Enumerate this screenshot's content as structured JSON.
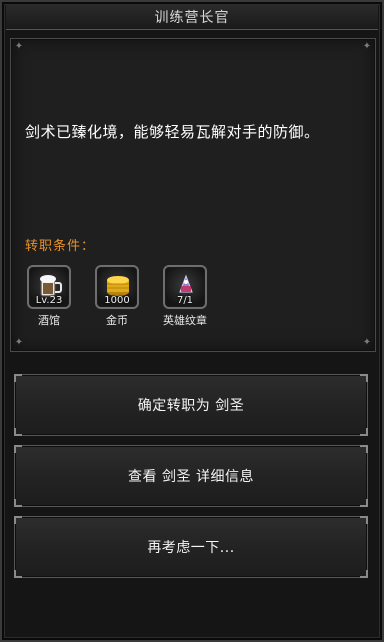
{
  "dialog": {
    "title": "训练营长官",
    "description": "剑术已臻化境，能够轻易瓦解对手的防御。",
    "conditions_label": "转职条件：",
    "requirements": [
      {
        "value": "Lv.23",
        "name": "酒馆",
        "icon": "tavern-icon"
      },
      {
        "value": "1000",
        "name": "金币",
        "icon": "gold-coin-icon"
      },
      {
        "value": "7/1",
        "name": "英雄纹章",
        "icon": "hero-emblem-icon"
      }
    ]
  },
  "buttons": {
    "confirm": "确定转职为 剑圣",
    "details": "查看 剑圣 详细信息",
    "reconsider": "再考虑一下..."
  },
  "colors": {
    "background": "#151515",
    "panel": "#1f1f1f",
    "accent_orange": "#e6922c",
    "text": "#ffffff"
  }
}
